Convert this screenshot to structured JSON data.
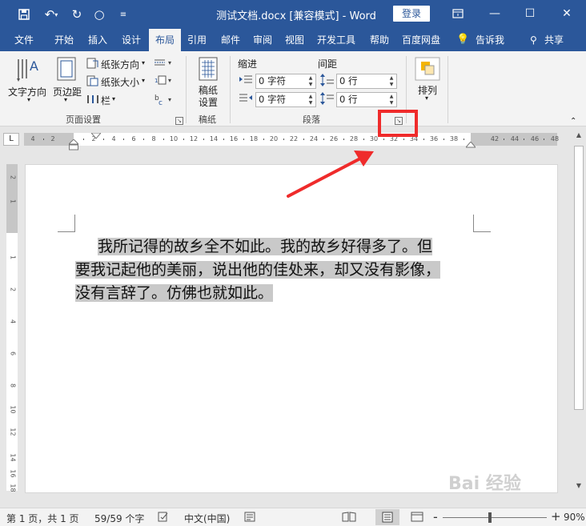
{
  "window": {
    "title": "测试文档.docx [兼容模式] - Word",
    "login_label": "登录"
  },
  "tabs": [
    {
      "label": "文件"
    },
    {
      "label": "开始"
    },
    {
      "label": "插入"
    },
    {
      "label": "设计"
    },
    {
      "label": "布局"
    },
    {
      "label": "引用"
    },
    {
      "label": "邮件"
    },
    {
      "label": "审阅"
    },
    {
      "label": "视图"
    },
    {
      "label": "开发工具"
    },
    {
      "label": "帮助"
    },
    {
      "label": "百度网盘"
    },
    {
      "label": "告诉我"
    },
    {
      "label": "共享"
    }
  ],
  "ribbon": {
    "text_direction": "文字方向",
    "margins": "页边距",
    "orientation": "纸张方向",
    "size": "纸张大小",
    "columns": "栏",
    "page_setup_group": "页面设置",
    "draft_paper_line1": "稿纸",
    "draft_paper_line2": "设置",
    "draft_group": "稿纸",
    "indent_header": "缩进",
    "spacing_header": "间距",
    "indent_left": "0 字符",
    "indent_right": "0 字符",
    "spacing_before": "0 行",
    "spacing_after": "0 行",
    "paragraph_group": "段落",
    "arrange": "排列"
  },
  "ruler": {
    "corner": "L",
    "labels": [
      "4",
      "2",
      "2",
      "4",
      "6",
      "8",
      "10",
      "12",
      "14",
      "16",
      "18",
      "20",
      "22",
      "24",
      "26",
      "28",
      "30",
      "32",
      "34",
      "36",
      "38",
      "42",
      "44",
      "46",
      "48"
    ],
    "vlabels": [
      "2",
      "1",
      "1",
      "2",
      "4",
      "6",
      "8",
      "10",
      "12",
      "14",
      "16",
      "18"
    ]
  },
  "document": {
    "lines": [
      "我所记得的故乡全不如此。我的故乡好得多了。但",
      "要我记起他的美丽，说出他的佳处来，却又没有影像，",
      "没有言辞了。仿佛也就如此。"
    ]
  },
  "status": {
    "page": "第 1 页，共 1 页",
    "words": "59/59 个字",
    "language": "中文(中国)",
    "zoom": "90%",
    "zoom_minus": "-",
    "zoom_plus": "+",
    "zoom_level": 0.45
  },
  "watermark": "Bai 经验",
  "colors": {
    "accent": "#2b579a",
    "highlight": "#c9c9c9",
    "annotation": "#ef2b2b"
  }
}
